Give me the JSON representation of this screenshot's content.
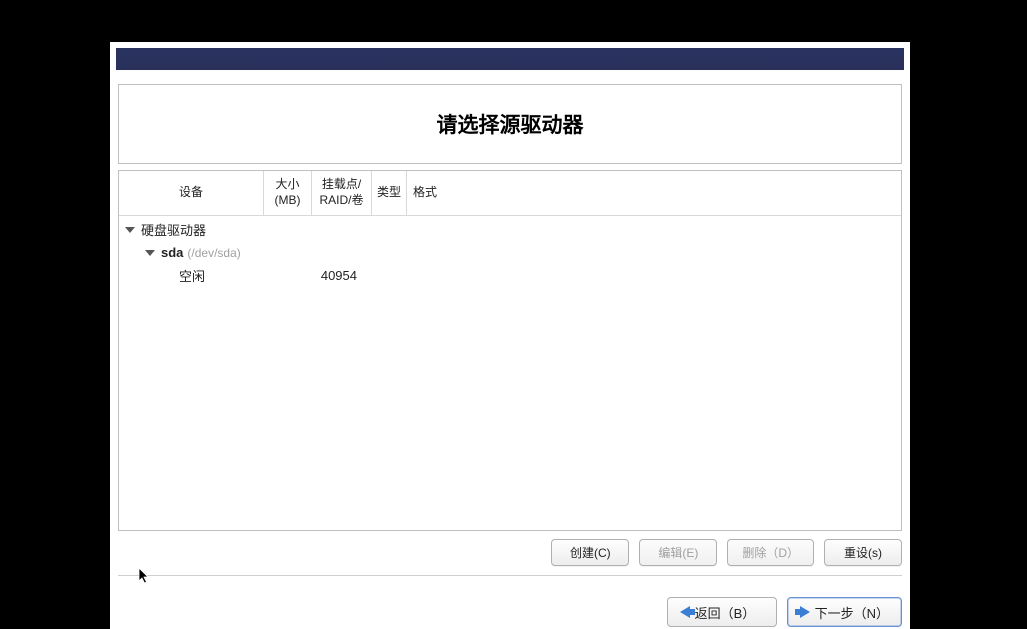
{
  "title": "请选择源驱动器",
  "columns": {
    "device": "设备",
    "size_line1": "大小",
    "size_line2": "(MB)",
    "mount_line1": "挂载点/",
    "mount_line2": "RAID/卷",
    "type": "类型",
    "format": "格式"
  },
  "tree": {
    "root": {
      "label": "硬盘驱动器"
    },
    "disk": {
      "name": "sda",
      "path": "(/dev/sda)"
    },
    "partition": {
      "name": "空闲",
      "size": "40954"
    }
  },
  "buttons": {
    "create": "创建(C)",
    "edit": "编辑(E)",
    "delete": "删除（D）",
    "reset": "重设(s)"
  },
  "nav": {
    "back": "返回（B）",
    "next": "下一步（N）"
  }
}
